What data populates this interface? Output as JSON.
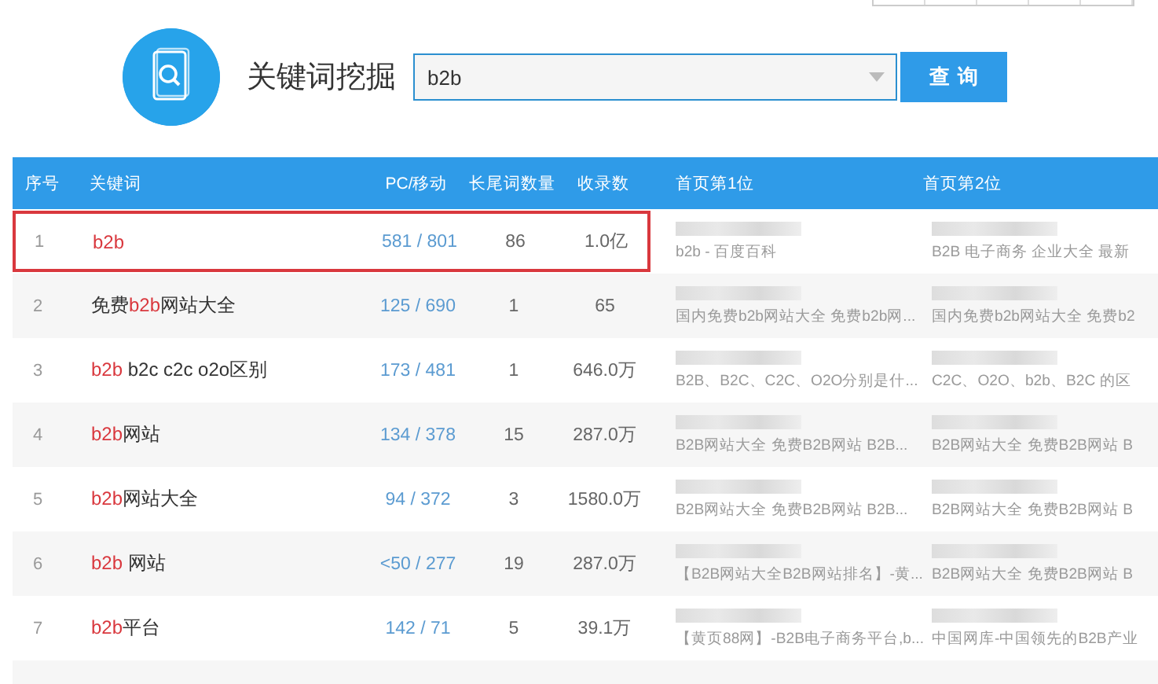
{
  "header": {
    "title": "关键词挖掘",
    "search": {
      "value": "b2b"
    },
    "button": "查 询"
  },
  "table": {
    "columns": [
      "序号",
      "关键词",
      "PC/移动",
      "长尾词数量",
      "收录数",
      "首页第1位",
      "首页第2位"
    ],
    "rows": [
      {
        "index": "1",
        "keyword": [
          {
            "text": "b2b",
            "highlight": true
          }
        ],
        "pc_mobile": "581 / 801",
        "long_tail": "86",
        "indexed": "1.0亿",
        "rank_1": "b2b - 百度百科",
        "rank_2": "B2B 电子商务 企业大全 最新",
        "selected": true
      },
      {
        "index": "2",
        "keyword": [
          {
            "text": "免费",
            "highlight": false
          },
          {
            "text": "b2b",
            "highlight": true
          },
          {
            "text": "网站大全",
            "highlight": false
          }
        ],
        "pc_mobile": "125 / 690",
        "long_tail": "1",
        "indexed": "65",
        "rank_1": "国内免费b2b网站大全 免费b2b网...",
        "rank_2": "国内免费b2b网站大全 免费b2",
        "selected": false
      },
      {
        "index": "3",
        "keyword": [
          {
            "text": "b2b",
            "highlight": true
          },
          {
            "text": " b2c c2c o2o区别",
            "highlight": false
          }
        ],
        "pc_mobile": "173 / 481",
        "long_tail": "1",
        "indexed": "646.0万",
        "rank_1": "B2B、B2C、C2C、O2O分别是什...",
        "rank_2": "C2C、O2O、b2b、B2C 的区",
        "selected": false
      },
      {
        "index": "4",
        "keyword": [
          {
            "text": "b2b",
            "highlight": true
          },
          {
            "text": "网站",
            "highlight": false
          }
        ],
        "pc_mobile": "134 / 378",
        "long_tail": "15",
        "indexed": "287.0万",
        "rank_1": "B2B网站大全 免费B2B网站 B2B...",
        "rank_2": "B2B网站大全 免费B2B网站 B",
        "selected": false
      },
      {
        "index": "5",
        "keyword": [
          {
            "text": "b2b",
            "highlight": true
          },
          {
            "text": "网站大全",
            "highlight": false
          }
        ],
        "pc_mobile": "94 / 372",
        "long_tail": "3",
        "indexed": "1580.0万",
        "rank_1": "B2B网站大全 免费B2B网站 B2B...",
        "rank_2": "B2B网站大全 免费B2B网站 B",
        "selected": false
      },
      {
        "index": "6",
        "keyword": [
          {
            "text": "b2b",
            "highlight": true
          },
          {
            "text": " 网站",
            "highlight": false
          }
        ],
        "pc_mobile": "<50 / 277",
        "long_tail": "19",
        "indexed": "287.0万",
        "rank_1": "【B2B网站大全B2B网站排名】-黄...",
        "rank_2": "B2B网站大全 免费B2B网站 B",
        "selected": false
      },
      {
        "index": "7",
        "keyword": [
          {
            "text": "b2b",
            "highlight": true
          },
          {
            "text": "平台",
            "highlight": false
          }
        ],
        "pc_mobile": "142 / 71",
        "long_tail": "5",
        "indexed": "39.1万",
        "rank_1": "【黄页88网】-B2B电子商务平台,b...",
        "rank_2": "中国网库-中国领先的B2B产业",
        "selected": false
      }
    ]
  }
}
